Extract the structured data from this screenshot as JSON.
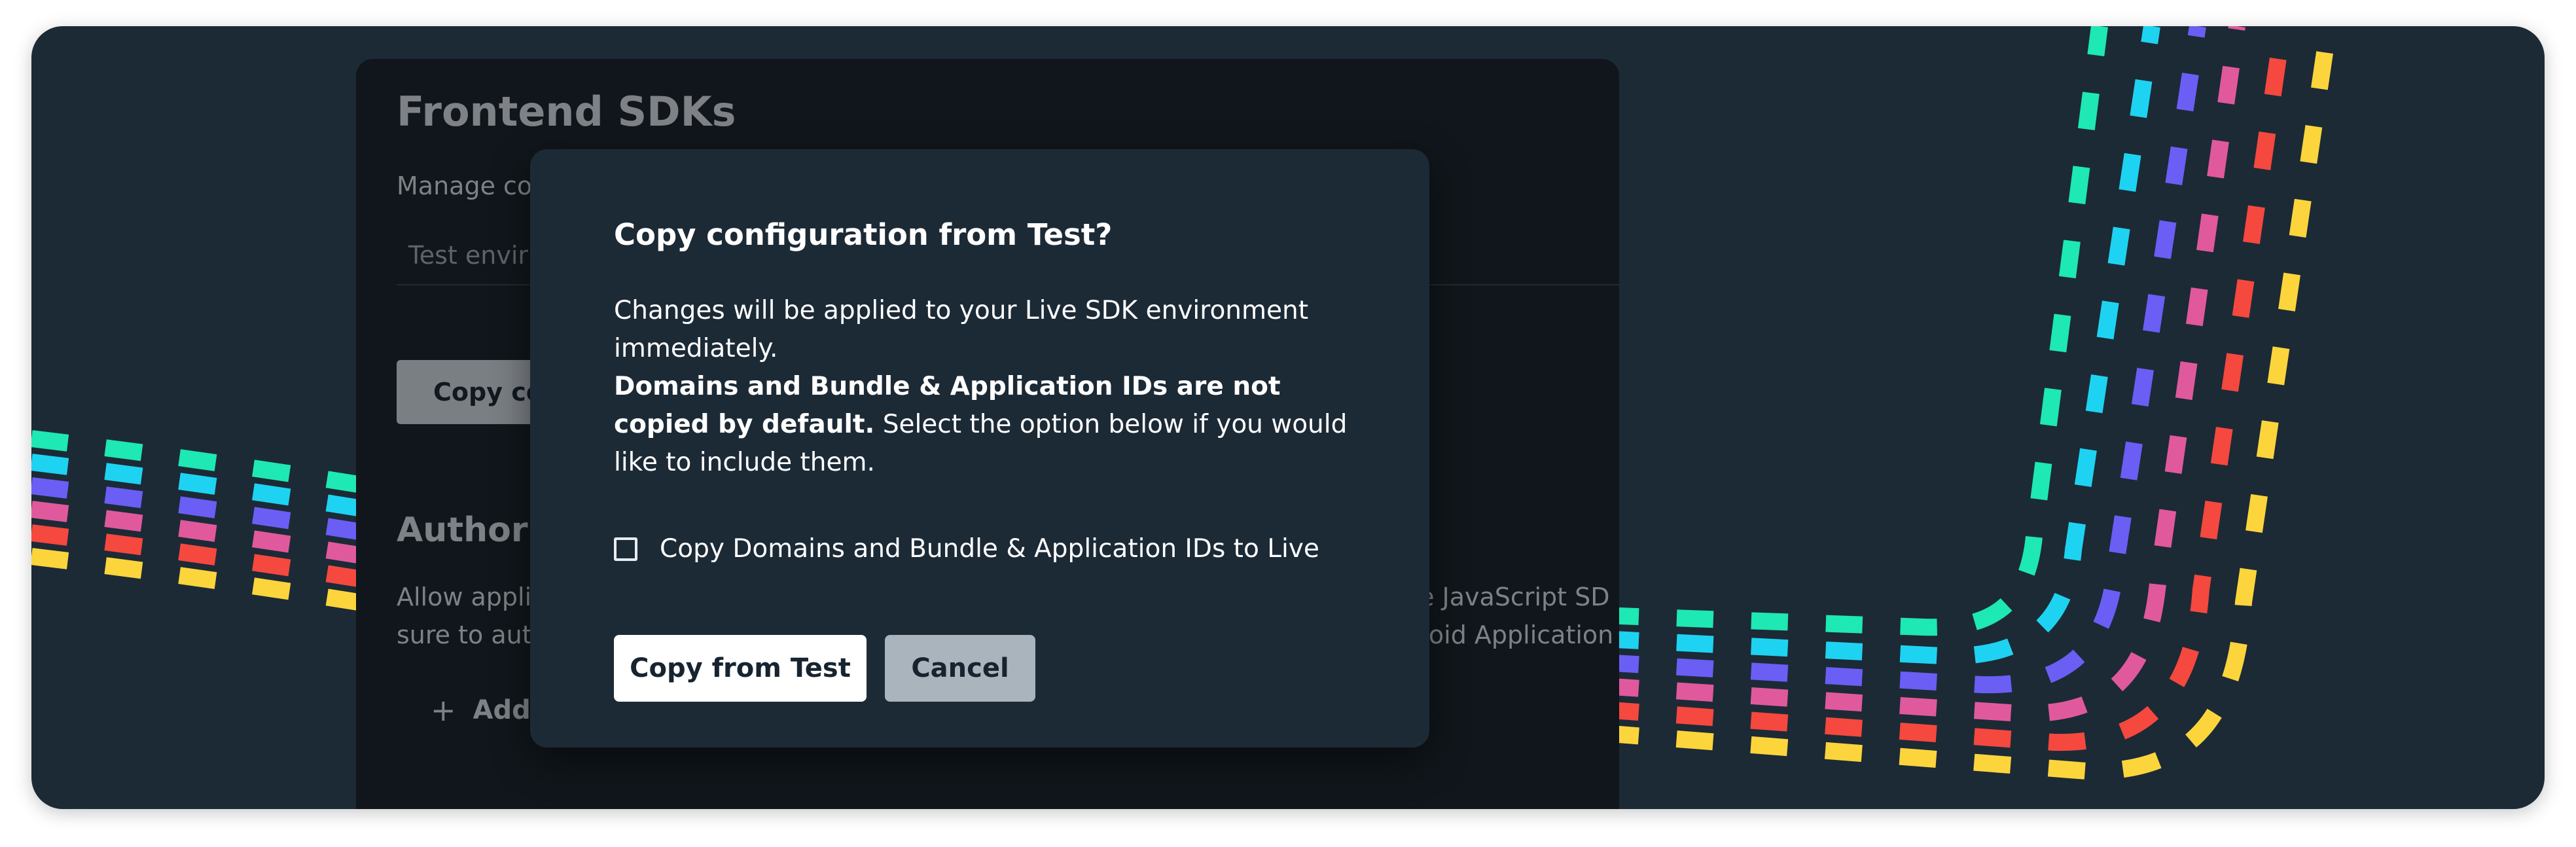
{
  "background_panel": {
    "title": "Frontend SDKs",
    "description": "Manage co",
    "tab": "Test envir",
    "copy_button": "Copy co",
    "auth_title": "Authoriz",
    "auth_desc_line1": "Allow appli",
    "auth_desc_line2": "sure to aut",
    "auth_desc_right1": "he JavaScript SD",
    "auth_desc_right2": "droid Application",
    "add_label": "Add",
    "add_icon": "plus-icon"
  },
  "modal": {
    "title": "Copy configuration from Test?",
    "body_intro": "Changes will be applied to your Live SDK environment immediately.",
    "body_bold": "Domains and Bundle & Application IDs are not copied by default.",
    "body_rest": " Select the option below if you would like to include them.",
    "checkbox_label": "Copy Domains and Bundle & Application IDs to Live",
    "checkbox_checked": false,
    "primary_button": "Copy from Test",
    "secondary_button": "Cancel"
  },
  "colors": {
    "canvas": "#1c2a36",
    "panel": "#10161b",
    "stripes": [
      "#1ee8b4",
      "#1ed3f1",
      "#6a5ef5",
      "#e0599d",
      "#f5483f",
      "#fcd53c"
    ]
  }
}
